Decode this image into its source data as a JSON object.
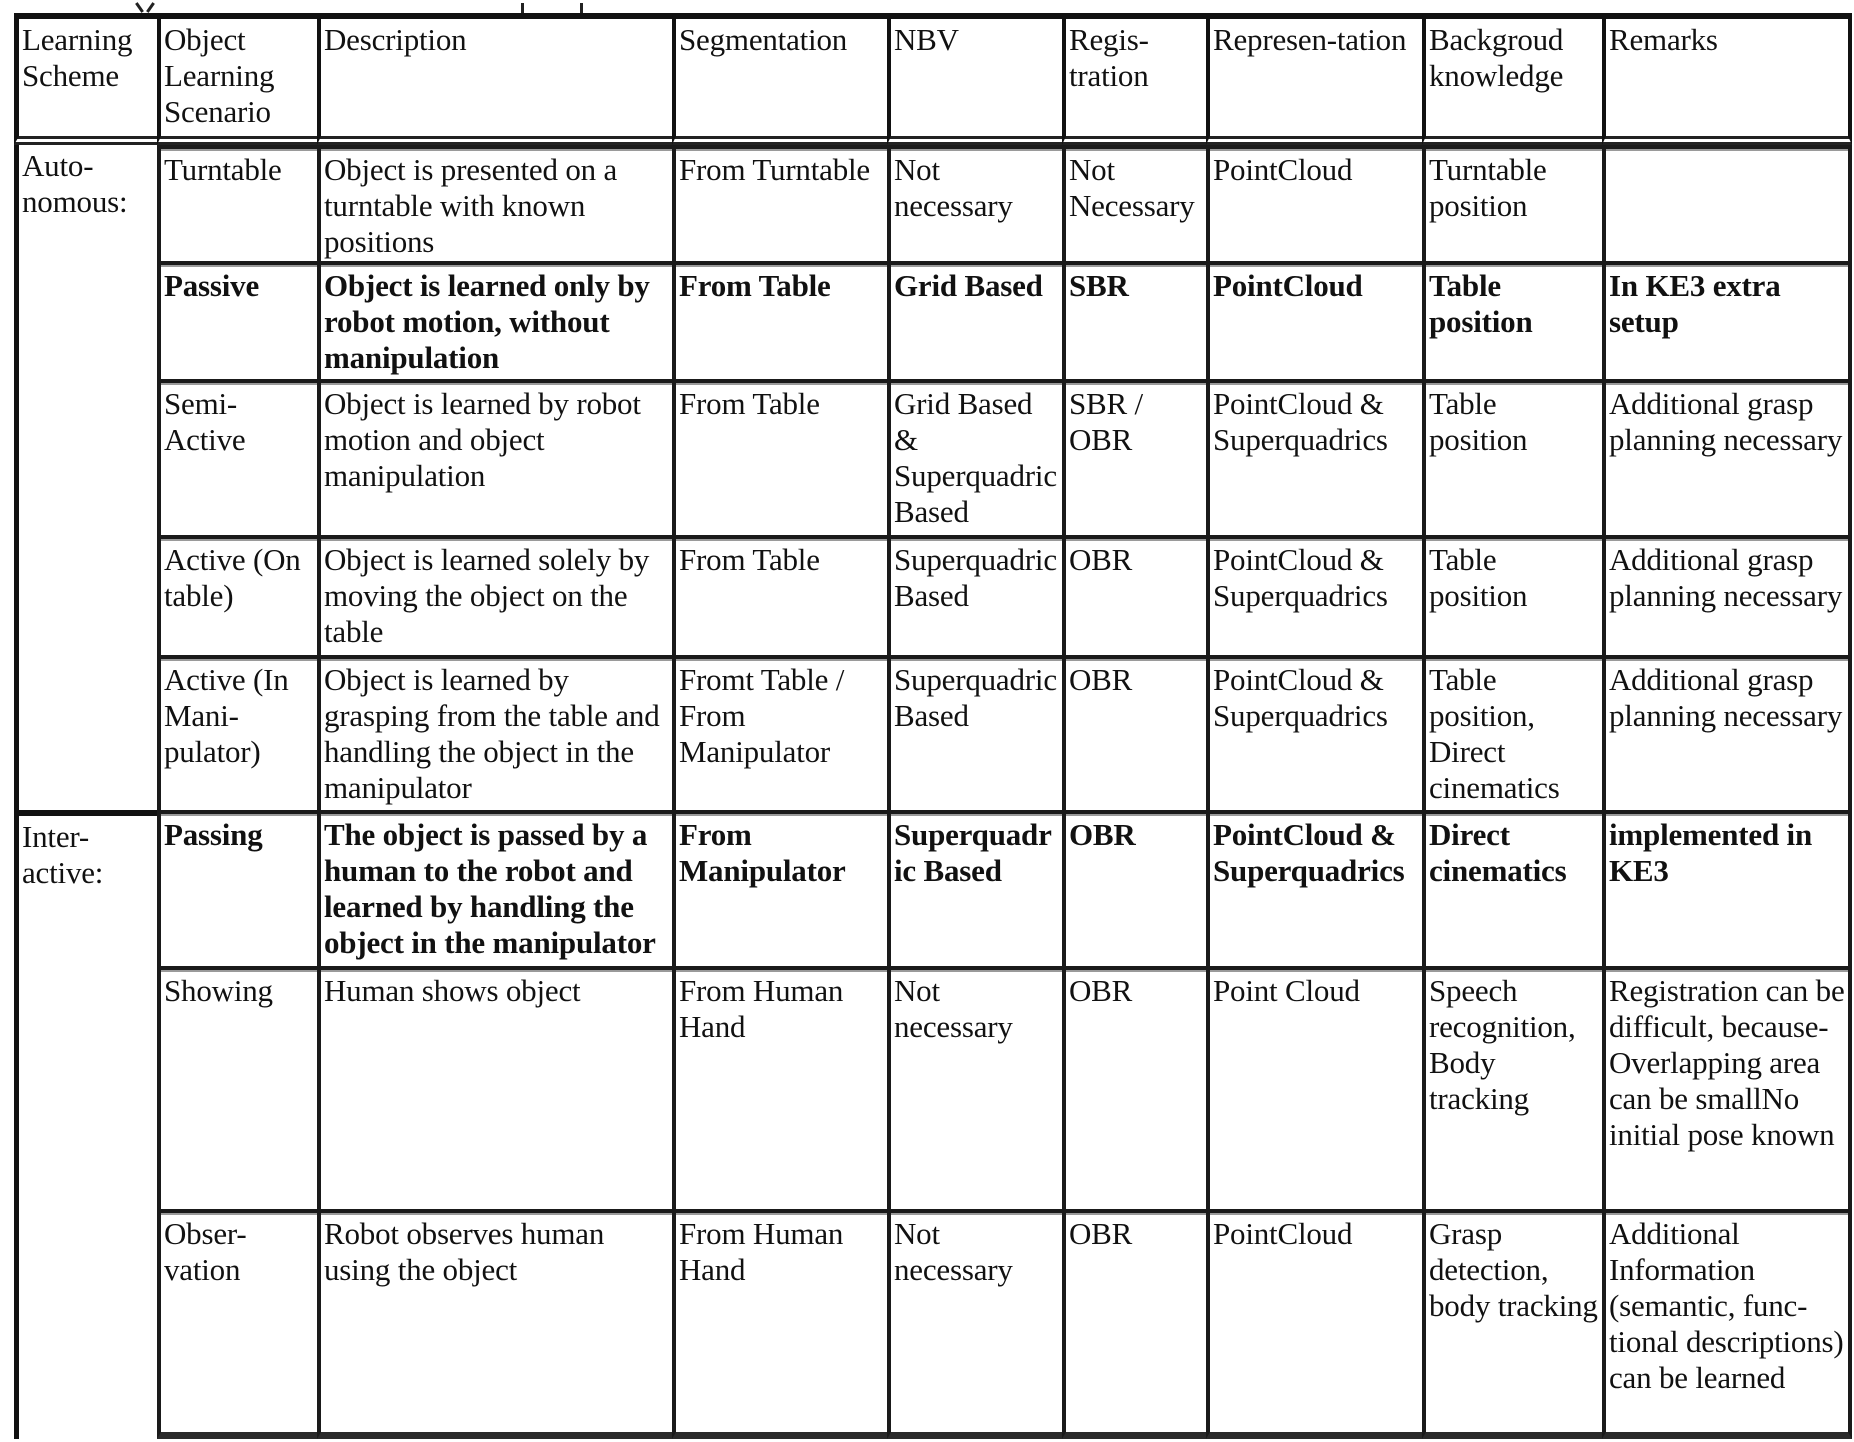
{
  "header": {
    "learning_scheme": "Learning Scheme",
    "scenario": "Object Learning Scenario",
    "description": "Description",
    "segmentation": "Segmentation",
    "nbv": "NBV",
    "registration": "Regis-tration",
    "representation": "Represen-tation",
    "background": "Backgroud knowledge",
    "remarks": "Remarks"
  },
  "groups": [
    {
      "scheme": "Auto-nomous:",
      "rows": [
        {
          "bold": false,
          "scenario": "Turntable",
          "description": "Object is presented on a turntable with known positions",
          "segmentation": "From Turntable",
          "nbv": "Not necessary",
          "registration": "Not Necessary",
          "representation": "PointCloud",
          "background": "Turntable position",
          "remarks": ""
        },
        {
          "bold": true,
          "scenario": "Passive",
          "description": "Object is learned only by robot motion, without manipulation",
          "segmentation": "From Table",
          "nbv": "Grid Based",
          "registration": "SBR",
          "representation": "PointCloud",
          "background": "Table position",
          "remarks": "In KE3 extra setup"
        },
        {
          "bold": false,
          "scenario": "Semi-Active",
          "description": "Object is learned by robot motion and object manipulation",
          "segmentation": "From Table",
          "nbv": "Grid Based & Superquadric Based",
          "registration": "SBR / OBR",
          "representation": "PointCloud & Superquadrics",
          "background": "Table position",
          "remarks": "Additional grasp planning necessary"
        },
        {
          "bold": false,
          "scenario": "Active (On table)",
          "description": "Object is learned solely by moving the object on the table",
          "segmentation": "From Table",
          "nbv": "Superquadric Based",
          "registration": "OBR",
          "representation": "PointCloud & Superquadrics",
          "background": "Table position",
          "remarks": "Additional grasp planning necessary"
        },
        {
          "bold": false,
          "scenario": "Active (In Mani-pulator)",
          "description": "Object is learned by grasping from the table and handling the object in the manipulator",
          "segmentation": "Fromt Table / From Manipulator",
          "nbv": "Superquadric Based",
          "registration": "OBR",
          "representation": "PointCloud & Superquadrics",
          "background": "Table position, Direct cinematics",
          "remarks": "Additional grasp planning necessary"
        }
      ]
    },
    {
      "scheme": "Inter-active:",
      "rows": [
        {
          "bold": true,
          "scenario": "Passing",
          "description": "The object is passed by a human to the robot and learned by handling the object in the manipulator",
          "segmentation": "From Manipulator",
          "nbv": "Superquadric Based",
          "registration": "OBR",
          "representation": "PointCloud & Superquadrics",
          "background": "Direct cinematics",
          "remarks": "implemented in KE3"
        },
        {
          "bold": false,
          "scenario": "Showing",
          "description": "Human shows object",
          "segmentation": "From Human Hand",
          "nbv": "Not necessary",
          "registration": "OBR",
          "representation": "Point Cloud",
          "background": "Speech recognition, Body tracking",
          "remarks": "Registration can be difficult, because-Overlapping area can be smallNo initial pose known"
        },
        {
          "bold": false,
          "scenario": "Obser-vation",
          "description": "Robot observes human using the object",
          "segmentation": "From Human Hand",
          "nbv": "Not necessary",
          "registration": "OBR",
          "representation": "PointCloud",
          "background": "Grasp detection, body tracking",
          "remarks": "Additional Information (semantic, func-tional descriptions) can be learned"
        }
      ]
    }
  ]
}
